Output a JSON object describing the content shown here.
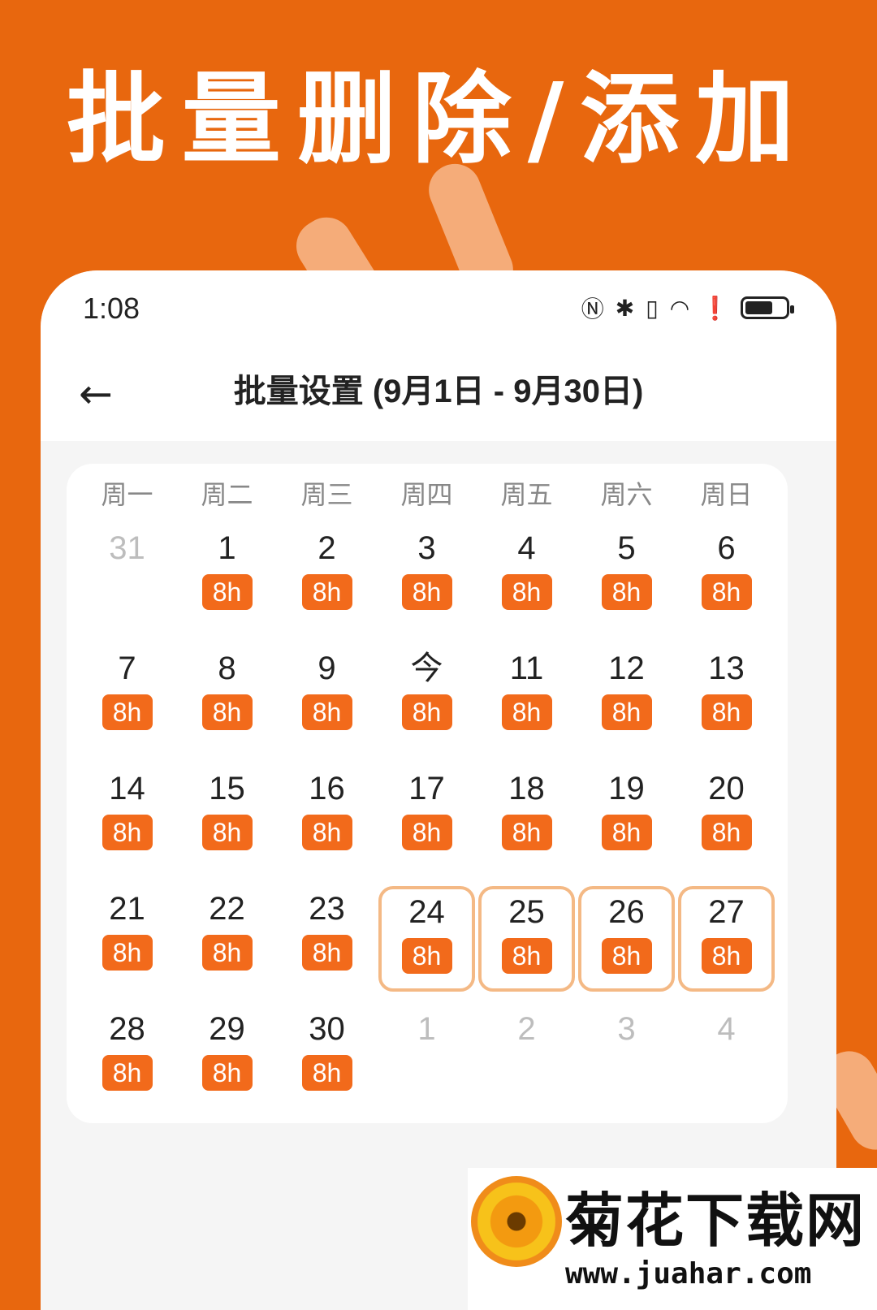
{
  "banner": {
    "title": "批量删除/添加"
  },
  "status_bar": {
    "time": "1:08"
  },
  "header": {
    "back_icon": "←",
    "title": "批量设置 (9月1日 - 9月30日)"
  },
  "calendar": {
    "weekdays": [
      "周一",
      "周二",
      "周三",
      "周四",
      "周五",
      "周六",
      "周日"
    ],
    "days": [
      {
        "label": "31",
        "badge": "",
        "muted": true
      },
      {
        "label": "1",
        "badge": "8h"
      },
      {
        "label": "2",
        "badge": "8h"
      },
      {
        "label": "3",
        "badge": "8h"
      },
      {
        "label": "4",
        "badge": "8h"
      },
      {
        "label": "5",
        "badge": "8h"
      },
      {
        "label": "6",
        "badge": "8h"
      },
      {
        "label": "7",
        "badge": "8h"
      },
      {
        "label": "8",
        "badge": "8h"
      },
      {
        "label": "9",
        "badge": "8h"
      },
      {
        "label": "今",
        "badge": "8h"
      },
      {
        "label": "11",
        "badge": "8h"
      },
      {
        "label": "12",
        "badge": "8h"
      },
      {
        "label": "13",
        "badge": "8h"
      },
      {
        "label": "14",
        "badge": "8h"
      },
      {
        "label": "15",
        "badge": "8h"
      },
      {
        "label": "16",
        "badge": "8h"
      },
      {
        "label": "17",
        "badge": "8h"
      },
      {
        "label": "18",
        "badge": "8h"
      },
      {
        "label": "19",
        "badge": "8h"
      },
      {
        "label": "20",
        "badge": "8h"
      },
      {
        "label": "21",
        "badge": "8h"
      },
      {
        "label": "22",
        "badge": "8h"
      },
      {
        "label": "23",
        "badge": "8h"
      },
      {
        "label": "24",
        "badge": "8h",
        "selected": true
      },
      {
        "label": "25",
        "badge": "8h",
        "selected": true
      },
      {
        "label": "26",
        "badge": "8h",
        "selected": true
      },
      {
        "label": "27",
        "badge": "8h",
        "selected": true
      },
      {
        "label": "28",
        "badge": "8h"
      },
      {
        "label": "29",
        "badge": "8h"
      },
      {
        "label": "30",
        "badge": "8h"
      },
      {
        "label": "1",
        "badge": "",
        "muted": true
      },
      {
        "label": "2",
        "badge": "",
        "muted": true
      },
      {
        "label": "3",
        "badge": "",
        "muted": true
      },
      {
        "label": "4",
        "badge": "",
        "muted": true
      }
    ]
  },
  "watermark": {
    "title": "菊花下载网",
    "url": "www.juahar.com"
  },
  "colors": {
    "background": "#E8670E",
    "badge": "#F26A1B",
    "selected_border": "#F4B985"
  }
}
